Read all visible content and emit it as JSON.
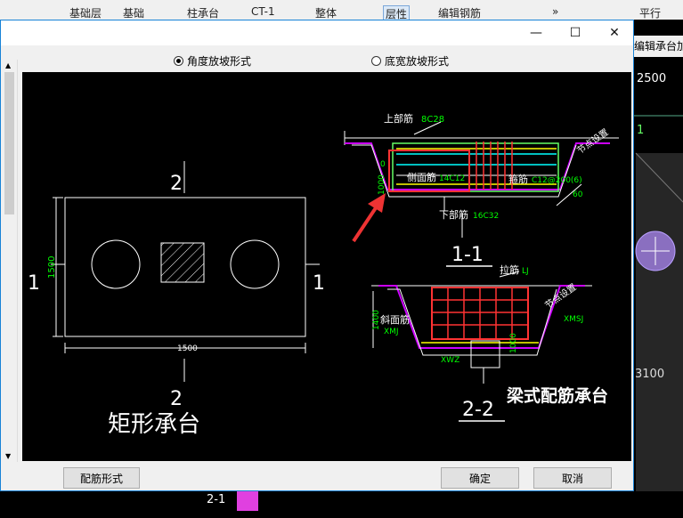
{
  "background": {
    "tabs": [
      "基础层",
      "基础",
      "柱承台",
      "CT-1",
      "整体",
      "层性",
      "编辑钢筋"
    ],
    "right_panel": {
      "header": "编辑承台加",
      "value_a": "2500",
      "value_b": "1",
      "value_c": "3100"
    },
    "toolbar_right": {
      "more": "»",
      "parallel": "平行"
    },
    "bottom_label": "2-1"
  },
  "dialog": {
    "options": {
      "angle_slope": "角度放坡形式",
      "bottom_width_slope": "底宽放坡形式"
    },
    "buttons": {
      "rebar_form": "配筋形式",
      "ok": "确定",
      "cancel": "取消"
    }
  },
  "drawing": {
    "rect_cap": {
      "section_top": "2",
      "section_bottom": "2",
      "section_left": "1",
      "section_right": "1",
      "dim_side": "1500",
      "dim_bottom": "1500",
      "caption": "矩形承台"
    },
    "section_1_1": {
      "top_bar_label": "上部筋",
      "top_bar_value": "8C28",
      "side_bar_label": "侧面筋",
      "side_bar_value": "14C12",
      "stirrup_label": "箍筋",
      "stirrup_value": "C12@200(6)",
      "bottom_bar_label": "下部筋",
      "bottom_bar_value": "16C32",
      "node_label": "节点设置",
      "angle": "60",
      "dim_a": "0",
      "dim_b": "1000",
      "title": "1-1"
    },
    "section_2_2": {
      "tie_label": "拉筋",
      "tie_value": "LJ",
      "slope_label": "斜面筋",
      "slope_value": "XMJ",
      "xmsj": "XMSJ",
      "xwz": "XWZ",
      "node_label": "节点设置",
      "dim_h": "1400",
      "dim_b": "1000",
      "title": "2-2"
    },
    "beam_caption": "梁式配筋承台"
  }
}
